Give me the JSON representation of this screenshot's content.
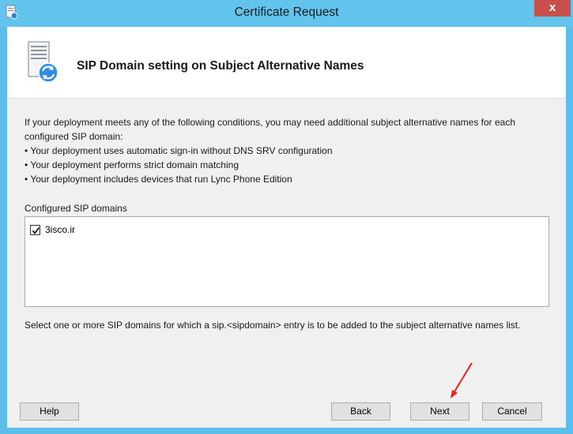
{
  "window": {
    "title": "Certificate Request",
    "close_label": "x"
  },
  "header": {
    "title": "SIP Domain setting on Subject Alternative Names"
  },
  "content": {
    "intro": "If your deployment meets any of the following conditions, you may need additional subject alternative names for each configured SIP domain:",
    "bullets": [
      "• Your deployment uses automatic sign-in without DNS SRV configuration",
      "• Your deployment performs strict domain matching",
      "• Your deployment includes devices that run Lync Phone Edition"
    ]
  },
  "domains": {
    "label": "Configured SIP domains",
    "items": [
      {
        "name": "3isco.ir",
        "checked": true
      }
    ]
  },
  "hint": "Select one or more SIP domains for which a sip.<sipdomain> entry is to be added to the subject alternative names list.",
  "buttons": {
    "help": "Help",
    "back": "Back",
    "next": "Next",
    "cancel": "Cancel"
  },
  "colors": {
    "titlebar": "#62c3ec",
    "close": "#c7504c",
    "annotation_arrow": "#e0261e"
  },
  "icons": {
    "app": "certificate-app-icon",
    "header": "server-sync-icon",
    "close": "close-icon",
    "check": "checkmark-icon",
    "annotation": "red-arrow-annotation"
  }
}
